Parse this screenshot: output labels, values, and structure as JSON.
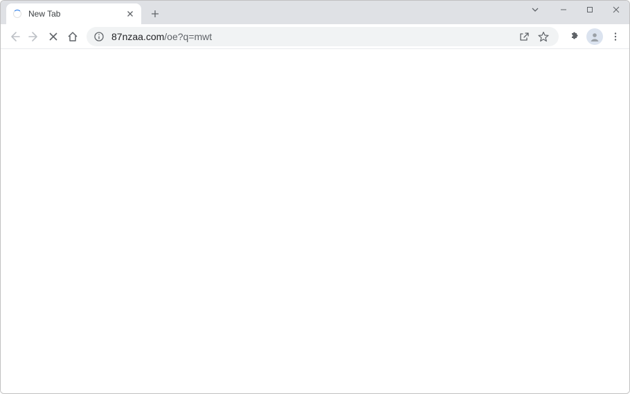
{
  "tab": {
    "title": "New Tab"
  },
  "url": {
    "domain": "87nzaa.com",
    "path": "/oe?q=mwt"
  }
}
